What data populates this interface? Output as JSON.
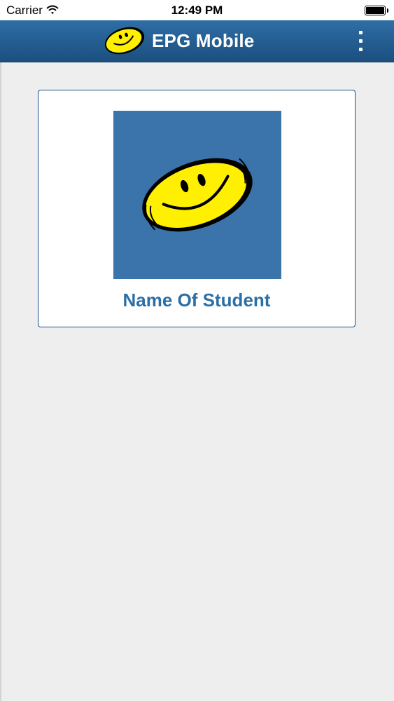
{
  "status_bar": {
    "carrier": "Carrier",
    "time": "12:49 PM"
  },
  "app_bar": {
    "title": "EPG Mobile",
    "logo_icon": "smiley-face-icon",
    "menu_icon": "more-vertical-icon"
  },
  "student_card": {
    "photo_icon": "smiley-face-icon",
    "name": "Name Of Student"
  },
  "colors": {
    "app_bar": "#235d93",
    "accent_text": "#2c6fa6",
    "photo_bg": "#3a74aa",
    "smiley_yellow": "#ffef00"
  }
}
